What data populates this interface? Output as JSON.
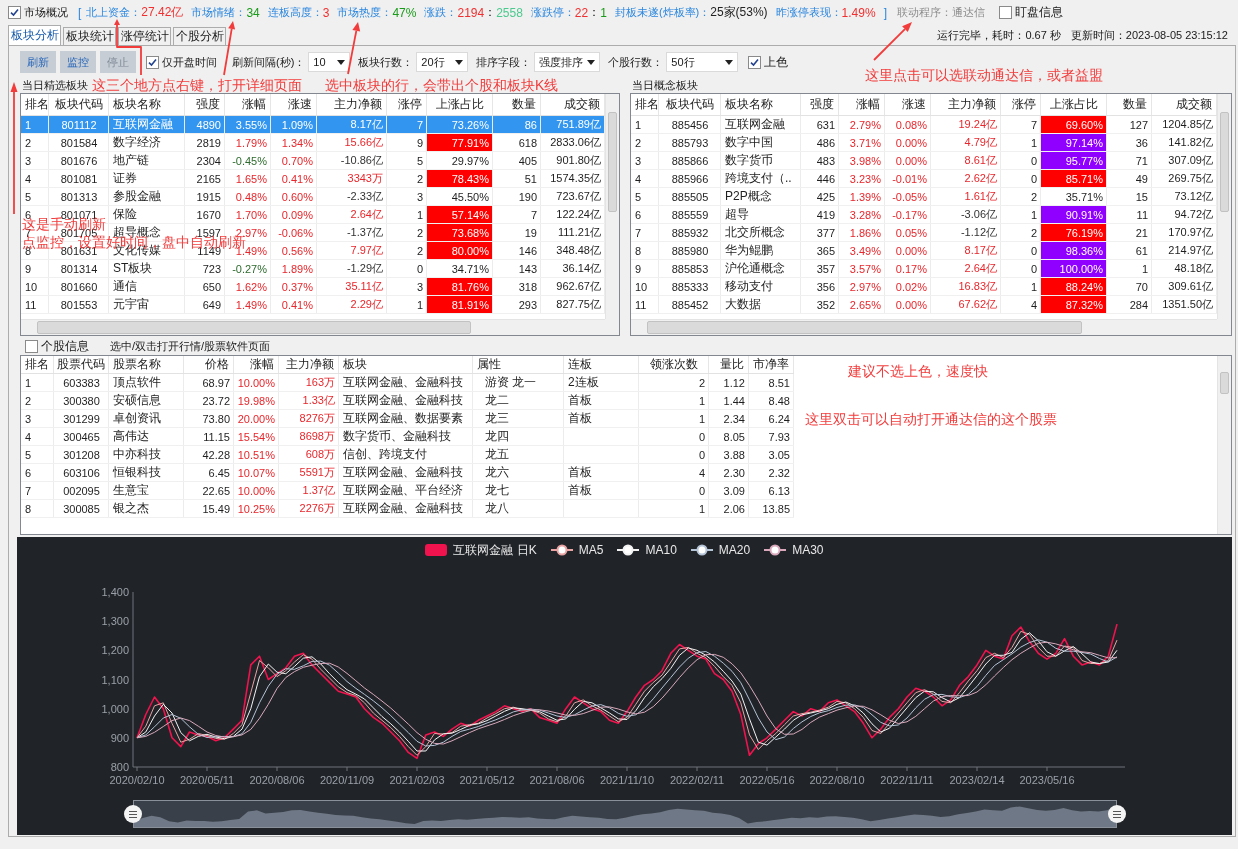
{
  "market_bar": {
    "overview_checkbox": {
      "label": "市场概况",
      "checked": true
    },
    "open_bracket": "[",
    "stats": [
      {
        "label": "北上资金：",
        "values": [
          {
            "text": "27.42亿",
            "color": "#f03030"
          }
        ]
      },
      {
        "label": "市场情绪：",
        "values": [
          {
            "text": "34",
            "color": "#1a9a1a"
          }
        ]
      },
      {
        "label": "连板高度：",
        "values": [
          {
            "text": "3",
            "color": "#f03030"
          }
        ]
      },
      {
        "label": "市场热度：",
        "values": [
          {
            "text": "47%",
            "color": "#1a9a1a"
          }
        ]
      },
      {
        "label": "涨跌：",
        "values": [
          {
            "text": "2194",
            "color": "#f03030"
          },
          {
            "text": "："
          },
          {
            "text": "2558",
            "color": "#4cc98f"
          }
        ]
      },
      {
        "label": "涨跌停：",
        "values": [
          {
            "text": "22",
            "color": "#f03030"
          },
          {
            "text": "："
          },
          {
            "text": "1",
            "color": "#1a9a1a"
          }
        ]
      },
      {
        "label": "封板未遂(炸板率)：",
        "values": [
          {
            "text": "25家(53%)",
            "color": "#222222"
          }
        ]
      },
      {
        "label": "昨涨停表现：",
        "values": [
          {
            "text": "1.49%",
            "color": "#f03030"
          }
        ]
      }
    ],
    "close_bracket": "]",
    "link_program": "联动程序：通达信",
    "watch_checkbox": {
      "label": "盯盘信息",
      "checked": false
    }
  },
  "tabs": [
    {
      "label": "板块分析",
      "selected": true
    },
    {
      "label": "板块统计",
      "selected": false
    },
    {
      "label": "涨停统计",
      "selected": false
    },
    {
      "label": "个股分析",
      "selected": false
    }
  ],
  "run_status": {
    "elapsed": "运行完毕，耗时：0.67 秒",
    "updated": "更新时间：2023-08-05 23:15:12"
  },
  "toolbar": {
    "buttons": [
      {
        "label": "刷新",
        "disabled": false
      },
      {
        "label": "监控",
        "disabled": false
      },
      {
        "label": "停止",
        "disabled": true
      }
    ],
    "open_time_checkbox": {
      "label": "仅开盘时间",
      "checked": true
    },
    "dropdowns": [
      {
        "label": "刷新间隔(秒)：",
        "value": "10"
      },
      {
        "label": "板块行数：",
        "value": "20行"
      },
      {
        "label": "排序字段：",
        "value": "强度排序"
      },
      {
        "label": "个股行数：",
        "value": "50行"
      }
    ],
    "color_checkbox": {
      "label": "上色",
      "checked": true
    }
  },
  "sector_panels": [
    {
      "title": "当日精选板块",
      "columns": [
        "排名",
        "板块代码",
        "板块名称",
        "强度",
        "涨幅",
        "涨速",
        "主力净额",
        "涨停",
        "上涨占比",
        "数量",
        "成交额"
      ],
      "rows": [
        {
          "rank": "1",
          "code": "801112",
          "name": "互联网金融",
          "strength": "4890",
          "change": "3.55%",
          "change_up": true,
          "speed": "1.09%",
          "net_flow": "8.17亿",
          "net_flow_up": true,
          "limit_up": "7",
          "rise_ratio": "73.26%",
          "count": "86",
          "turnover": "751.89亿",
          "selected": true
        },
        {
          "rank": "2",
          "code": "801584",
          "name": "数字经济",
          "strength": "2819",
          "change": "1.79%",
          "change_up": true,
          "speed": "1.34%",
          "net_flow": "15.66亿",
          "net_flow_up": true,
          "limit_up": "9",
          "rise_ratio": "77.91%",
          "color": "#ff0000",
          "count": "618",
          "turnover": "2833.06亿",
          "selected": false
        },
        {
          "rank": "3",
          "code": "801676",
          "name": "地产链",
          "strength": "2304",
          "change": "-0.45%",
          "change_up": false,
          "speed": "0.70%",
          "net_flow": "-10.86亿",
          "net_flow_up": false,
          "limit_up": "5",
          "rise_ratio": "29.97%",
          "count": "405",
          "turnover": "901.80亿",
          "selected": false
        },
        {
          "rank": "4",
          "code": "801081",
          "name": "证券",
          "strength": "2165",
          "change": "1.65%",
          "change_up": true,
          "speed": "0.41%",
          "net_flow": "3343万",
          "net_flow_up": true,
          "limit_up": "2",
          "rise_ratio": "78.43%",
          "color": "#ff0000",
          "count": "51",
          "turnover": "1574.35亿",
          "selected": false
        },
        {
          "rank": "5",
          "code": "801313",
          "name": "参股金融",
          "strength": "1915",
          "change": "0.48%",
          "change_up": true,
          "speed": "0.60%",
          "net_flow": "-2.33亿",
          "net_flow_up": false,
          "limit_up": "3",
          "rise_ratio": "45.50%",
          "count": "190",
          "turnover": "723.67亿",
          "selected": false
        },
        {
          "rank": "6",
          "code": "801071",
          "name": "保险",
          "strength": "1670",
          "change": "1.70%",
          "change_up": true,
          "speed": "0.09%",
          "net_flow": "2.64亿",
          "net_flow_up": true,
          "limit_up": "1",
          "rise_ratio": "57.14%",
          "color": "#ff0000",
          "count": "7",
          "turnover": "122.24亿",
          "selected": false
        },
        {
          "rank": "7",
          "code": "801705",
          "name": "超导概念",
          "strength": "1597",
          "change": "2.97%",
          "change_up": true,
          "speed": "-0.06%",
          "net_flow": "-1.37亿",
          "net_flow_up": false,
          "limit_up": "2",
          "rise_ratio": "73.68%",
          "color": "#ff0000",
          "count": "19",
          "turnover": "111.21亿",
          "selected": false
        },
        {
          "rank": "8",
          "code": "801631",
          "name": "文化传媒",
          "strength": "1149",
          "change": "1.49%",
          "change_up": true,
          "speed": "0.56%",
          "net_flow": "7.97亿",
          "net_flow_up": true,
          "limit_up": "2",
          "rise_ratio": "80.00%",
          "color": "#ff0000",
          "count": "146",
          "turnover": "348.48亿",
          "selected": false
        },
        {
          "rank": "9",
          "code": "801314",
          "name": "ST板块",
          "strength": "723",
          "change": "-0.27%",
          "change_up": false,
          "speed": "1.89%",
          "net_flow": "-1.29亿",
          "net_flow_up": false,
          "limit_up": "0",
          "rise_ratio": "34.71%",
          "count": "143",
          "turnover": "36.14亿",
          "selected": false
        },
        {
          "rank": "10",
          "code": "801660",
          "name": "通信",
          "strength": "650",
          "change": "1.62%",
          "change_up": true,
          "speed": "0.37%",
          "net_flow": "35.11亿",
          "net_flow_up": true,
          "limit_up": "3",
          "rise_ratio": "81.76%",
          "color": "#ff0000",
          "count": "318",
          "turnover": "962.67亿",
          "selected": false
        },
        {
          "rank": "11",
          "code": "801553",
          "name": "元宇宙",
          "strength": "649",
          "change": "1.49%",
          "change_up": true,
          "speed": "0.41%",
          "net_flow": "2.29亿",
          "net_flow_up": true,
          "limit_up": "1",
          "rise_ratio": "81.91%",
          "color": "#ff0000",
          "count": "293",
          "turnover": "827.75亿",
          "selected": false
        }
      ]
    },
    {
      "title": "当日概念板块",
      "columns": [
        "排名",
        "板块代码",
        "板块名称",
        "强度",
        "涨幅",
        "涨速",
        "主力净额",
        "涨停",
        "上涨占比",
        "数量",
        "成交额"
      ],
      "rows": [
        {
          "rank": "1",
          "code": "885456",
          "name": "互联网金融",
          "strength": "631",
          "change": "2.79%",
          "change_up": true,
          "speed": "0.08%",
          "net_flow": "19.24亿",
          "net_flow_up": true,
          "limit_up": "7",
          "rise_ratio": "69.60%",
          "color": "#ff0000",
          "count": "127",
          "turnover": "1204.85亿",
          "selected": false
        },
        {
          "rank": "2",
          "code": "885793",
          "name": "数字中国",
          "strength": "486",
          "change": "3.71%",
          "change_up": true,
          "speed": "0.00%",
          "net_flow": "4.79亿",
          "net_flow_up": true,
          "limit_up": "1",
          "rise_ratio": "97.14%",
          "color": "#9000ff",
          "count": "36",
          "turnover": "141.82亿",
          "selected": false
        },
        {
          "rank": "3",
          "code": "885866",
          "name": "数字货币",
          "strength": "483",
          "change": "3.98%",
          "change_up": true,
          "speed": "0.00%",
          "net_flow": "8.61亿",
          "net_flow_up": true,
          "limit_up": "0",
          "rise_ratio": "95.77%",
          "color": "#9000ff",
          "count": "71",
          "turnover": "307.09亿",
          "selected": false
        },
        {
          "rank": "4",
          "code": "885966",
          "name": "跨境支付（..",
          "strength": "446",
          "change": "3.23%",
          "change_up": true,
          "speed": "-0.01%",
          "net_flow": "2.62亿",
          "net_flow_up": true,
          "limit_up": "0",
          "rise_ratio": "85.71%",
          "color": "#ff0000",
          "count": "49",
          "turnover": "269.75亿",
          "selected": false
        },
        {
          "rank": "5",
          "code": "885505",
          "name": "P2P概念",
          "strength": "425",
          "change": "1.39%",
          "change_up": true,
          "speed": "-0.05%",
          "net_flow": "1.61亿",
          "net_flow_up": true,
          "limit_up": "2",
          "rise_ratio": "35.71%",
          "count": "15",
          "turnover": "73.12亿",
          "selected": false
        },
        {
          "rank": "6",
          "code": "885559",
          "name": "超导",
          "strength": "419",
          "change": "3.28%",
          "change_up": true,
          "speed": "-0.17%",
          "net_flow": "-3.06亿",
          "net_flow_up": false,
          "limit_up": "1",
          "rise_ratio": "90.91%",
          "color": "#9000ff",
          "count": "11",
          "turnover": "94.72亿",
          "selected": false
        },
        {
          "rank": "7",
          "code": "885932",
          "name": "北交所概念",
          "strength": "377",
          "change": "1.86%",
          "change_up": true,
          "speed": "0.05%",
          "net_flow": "-1.12亿",
          "net_flow_up": false,
          "limit_up": "2",
          "rise_ratio": "76.19%",
          "color": "#ff0000",
          "count": "21",
          "turnover": "170.97亿",
          "selected": false
        },
        {
          "rank": "8",
          "code": "885980",
          "name": "华为鲲鹏",
          "strength": "365",
          "change": "3.49%",
          "change_up": true,
          "speed": "0.00%",
          "net_flow": "8.17亿",
          "net_flow_up": true,
          "limit_up": "0",
          "rise_ratio": "98.36%",
          "color": "#9000ff",
          "count": "61",
          "turnover": "214.97亿",
          "selected": false
        },
        {
          "rank": "9",
          "code": "885853",
          "name": "沪伦通概念",
          "strength": "357",
          "change": "3.57%",
          "change_up": true,
          "speed": "0.17%",
          "net_flow": "2.64亿",
          "net_flow_up": true,
          "limit_up": "0",
          "rise_ratio": "100.00%",
          "color": "#9000ff",
          "count": "1",
          "turnover": "48.18亿",
          "selected": false
        },
        {
          "rank": "10",
          "code": "885333",
          "name": "移动支付",
          "strength": "356",
          "change": "2.97%",
          "change_up": true,
          "speed": "0.02%",
          "net_flow": "16.83亿",
          "net_flow_up": true,
          "limit_up": "1",
          "rise_ratio": "88.24%",
          "color": "#ff0000",
          "count": "70",
          "turnover": "309.61亿",
          "selected": false
        },
        {
          "rank": "11",
          "code": "885452",
          "name": "大数据",
          "strength": "352",
          "change": "2.65%",
          "change_up": true,
          "speed": "0.00%",
          "net_flow": "67.62亿",
          "net_flow_up": true,
          "limit_up": "4",
          "rise_ratio": "87.32%",
          "color": "#ff0000",
          "count": "284",
          "turnover": "1351.50亿",
          "selected": false
        }
      ]
    }
  ],
  "stock_panel": {
    "info_checkbox": {
      "label": "个股信息",
      "checked": false
    },
    "hint": "选中/双击打开行情/股票软件页面",
    "columns": [
      "排名",
      "股票代码",
      "股票名称",
      "价格",
      "涨幅",
      "主力净额",
      "板块",
      "属性",
      "连板",
      "领涨次数",
      "量比",
      "市净率"
    ],
    "rows": [
      {
        "rank": "1",
        "code": "603383",
        "name": "顶点软件",
        "price": "68.97",
        "change": "10.00%",
        "net_flow": "163万",
        "sectors": "互联网金融、金融科技",
        "attribute": "游资 龙一",
        "streak": "2连板",
        "lead_count": "2",
        "volume_ratio": "1.12",
        "pb": "8.51"
      },
      {
        "rank": "2",
        "code": "300380",
        "name": "安硕信息",
        "price": "23.72",
        "change": "19.98%",
        "net_flow": "1.33亿",
        "sectors": "互联网金融、金融科技",
        "attribute": "龙二",
        "streak": "首板",
        "lead_count": "1",
        "volume_ratio": "1.44",
        "pb": "8.48"
      },
      {
        "rank": "3",
        "code": "301299",
        "name": "卓创资讯",
        "price": "73.80",
        "change": "20.00%",
        "net_flow": "8276万",
        "sectors": "互联网金融、数据要素",
        "attribute": "龙三",
        "streak": "首板",
        "lead_count": "1",
        "volume_ratio": "2.34",
        "pb": "6.24"
      },
      {
        "rank": "4",
        "code": "300465",
        "name": "高伟达",
        "price": "11.15",
        "change": "15.54%",
        "net_flow": "8698万",
        "sectors": "数字货币、金融科技",
        "attribute": "龙四",
        "lead_count": "0",
        "volume_ratio": "8.05",
        "pb": "7.93"
      },
      {
        "rank": "5",
        "code": "301208",
        "name": "中亦科技",
        "price": "42.28",
        "change": "10.51%",
        "net_flow": "608万",
        "sectors": "信创、跨境支付",
        "attribute": "龙五",
        "lead_count": "0",
        "volume_ratio": "3.88",
        "pb": "3.05"
      },
      {
        "rank": "6",
        "code": "603106",
        "name": "恒银科技",
        "price": "6.45",
        "change": "10.07%",
        "net_flow": "5591万",
        "sectors": "互联网金融、金融科技",
        "attribute": "龙六",
        "streak": "首板",
        "lead_count": "4",
        "volume_ratio": "2.30",
        "pb": "2.32"
      },
      {
        "rank": "7",
        "code": "002095",
        "name": "生意宝",
        "price": "22.65",
        "change": "10.00%",
        "net_flow": "1.37亿",
        "sectors": "互联网金融、平台经济",
        "attribute": "龙七",
        "streak": "首板",
        "lead_count": "0",
        "volume_ratio": "3.09",
        "pb": "6.13"
      },
      {
        "rank": "8",
        "code": "300085",
        "name": "银之杰",
        "price": "15.49",
        "change": "10.25%",
        "net_flow": "2276万",
        "sectors": "互联网金融、金融科技",
        "attribute": "龙八",
        "lead_count": "1",
        "volume_ratio": "2.06",
        "pb": "13.85"
      }
    ]
  },
  "kline": {
    "chart_data": {
      "type": "line",
      "legend": "top",
      "categories": [
        "2020/02/10",
        null,
        null,
        null,
        null,
        null,
        null,
        null,
        "2020/05/11",
        null,
        null,
        null,
        null,
        null,
        null,
        null,
        "2020/08/06",
        null,
        null,
        null,
        null,
        null,
        null,
        null,
        "2020/11/09",
        null,
        null,
        null,
        null,
        null,
        null,
        null,
        "2021/02/03",
        null,
        null,
        null,
        null,
        null,
        null,
        null,
        "2021/05/12",
        null,
        null,
        null,
        null,
        null,
        null,
        null,
        "2021/08/06",
        null,
        null,
        null,
        null,
        null,
        null,
        null,
        "2021/11/10",
        null,
        null,
        null,
        null,
        null,
        null,
        null,
        "2022/02/11",
        null,
        null,
        null,
        null,
        null,
        null,
        null,
        "2022/05/16",
        null,
        null,
        null,
        null,
        null,
        null,
        null,
        "2022/08/10",
        null,
        null,
        null,
        null,
        null,
        null,
        null,
        "2022/11/11",
        null,
        null,
        null,
        null,
        null,
        null,
        null,
        "2023/02/14",
        null,
        null,
        null,
        null,
        null,
        null,
        null,
        "2023/05/16",
        null,
        null,
        null,
        null,
        null,
        null,
        null,
        null
      ],
      "yticks": [
        800,
        900,
        {
          "value": 1000,
          "label": "1,000"
        },
        {
          "value": 1100,
          "label": "1,100"
        },
        {
          "value": 1200,
          "label": "1,200"
        },
        {
          "value": 1300,
          "label": "1,300"
        },
        {
          "value": 1400,
          "label": "1,400"
        }
      ],
      "ylim": [
        800,
        1400
      ],
      "series": [
        {
          "name": "互联网金融 日K",
          "color": "#f0134d",
          "values": [
            900,
            980,
            1040,
            1000,
            900,
            870,
            920,
            910,
            905,
            890,
            900,
            930,
            960,
            1150,
            1180,
            1100,
            1120,
            1140,
            1180,
            1190,
            1150,
            1120,
            1090,
            1060,
            1050,
            1040,
            1000,
            970,
            950,
            920,
            890,
            850,
            830,
            910,
            920,
            905,
            930,
            950,
            940,
            960,
            975,
            990,
            1010,
            1000,
            990,
            1000,
            970,
            960,
            950,
            1000,
            1040,
            1020,
            1000,
            990,
            960,
            950,
            990,
            1040,
            1080,
            1100,
            1130,
            1190,
            1220,
            1200,
            1180,
            1170,
            1120,
            1100,
            1060,
            980,
            840,
            880,
            900,
            930,
            960,
            990,
            975,
            1000,
            990,
            1020,
            1030,
            1010,
            990,
            950,
            900,
            930,
            970,
            1000,
            1040,
            1070,
            1060,
            1040,
            1010,
            1030,
            1080,
            1110,
            1150,
            1200,
            1180,
            1170,
            1250,
            1280,
            1230,
            1190,
            1170,
            1190,
            1240,
            1180,
            1150,
            1160,
            1150,
            1180,
            1290
          ]
        },
        {
          "name": "MA5",
          "color": "#e9a3a3",
          "values": [
            900,
            940,
            1010,
            1020,
            950,
            885,
            895,
            915,
            908,
            898,
            895,
            915,
            945,
            1055,
            1165,
            1140,
            1110,
            1130,
            1160,
            1185,
            1170,
            1135,
            1105,
            1075,
            1055,
            1045,
            1020,
            985,
            960,
            935,
            905,
            870,
            840,
            870,
            915,
            913,
            918,
            940,
            945,
            950,
            968,
            983,
            1000,
            1005,
            995,
            995,
            985,
            965,
            955,
            975,
            1020,
            1030,
            1010,
            995,
            975,
            955,
            970,
            1015,
            1060,
            1090,
            1115,
            1160,
            1205,
            1210,
            1190,
            1175,
            1145,
            1110,
            1080,
            1020,
            910,
            860,
            890,
            915,
            945,
            975,
            983,
            988,
            995,
            1005,
            1025,
            1020,
            1000,
            970,
            925,
            915,
            950,
            985,
            1020,
            1055,
            1065,
            1050,
            1025,
            1020,
            1055,
            1095,
            1130,
            1175,
            1190,
            1175,
            1210,
            1265,
            1255,
            1210,
            1180,
            1180,
            1215,
            1210,
            1165,
            1155,
            1155,
            1165,
            1235
          ]
        },
        {
          "name": "MA10",
          "color": "#f2f2f2",
          "values": [
            900,
            920,
            975,
            1015,
            985,
            918,
            890,
            905,
            912,
            903,
            897,
            905,
            930,
            1000,
            1110,
            1153,
            1125,
            1120,
            1145,
            1173,
            1178,
            1153,
            1120,
            1090,
            1065,
            1050,
            1033,
            1003,
            973,
            948,
            920,
            888,
            855,
            855,
            893,
            914,
            916,
            929,
            943,
            948,
            959,
            975,
            991,
            1003,
            1000,
            995,
            990,
            975,
            960,
            965,
            998,
            1025,
            1020,
            1003,
            985,
            965,
            963,
            993,
            1038,
            1075,
            1103,
            1138,
            1183,
            1208,
            1200,
            1183,
            1160,
            1128,
            1095,
            1050,
            965,
            885,
            875,
            903,
            930,
            960,
            979,
            985,
            992,
            1000,
            1015,
            1023,
            1010,
            985,
            948,
            920,
            933,
            968,
            1003,
            1038,
            1060,
            1058,
            1038,
            1023,
            1038,
            1075,
            1113,
            1153,
            1183,
            1183,
            1193,
            1238,
            1260,
            1233,
            1195,
            1180,
            1198,
            1213,
            1188,
            1160,
            1155,
            1160,
            1200
          ]
        },
        {
          "name": "MA20",
          "color": "#b4c3d6",
          "values": [
            900,
            910,
            938,
            968,
            980,
            967,
            938,
            912,
            901,
            904,
            905,
            904,
            914,
            953,
            1020,
            1077,
            1118,
            1137,
            1135,
            1147,
            1162,
            1163,
            1149,
            1122,
            1093,
            1070,
            1049,
            1027,
            1003,
            976,
            947,
            918,
            888,
            872,
            874,
            885,
            905,
            922,
            930,
            939,
            951,
            962,
            975,
            989,
            996,
            999,
            995,
            985,
            975,
            970,
            979,
            995,
            1009,
            1014,
            1003,
            984,
            974,
            979,
            1001,
            1034,
            1071,
            1107,
            1143,
            1173,
            1192,
            1196,
            1180,
            1156,
            1128,
            1089,
            1030,
            968,
            920,
            894,
            903,
            932,
            955,
            973,
            986,
            993,
            1004,
            1012,
            1013,
            1004,
            979,
            953,
            941,
            944,
            968,
            1003,
            1032,
            1048,
            1049,
            1041,
            1038,
            1049,
            1076,
            1114,
            1148,
            1168,
            1188,
            1211,
            1227,
            1236,
            1228,
            1207,
            1197,
            1197,
            1193,
            1187,
            1172,
            1160,
            1178
          ]
        },
        {
          "name": "MA30",
          "color": "#d9a9bb",
          "values": [
            900,
            905,
            919,
            939,
            959,
            968,
            959,
            940,
            920,
            908,
            903,
            904,
            910,
            929,
            967,
            1015,
            1069,
            1107,
            1127,
            1142,
            1149,
            1155,
            1156,
            1143,
            1121,
            1096,
            1071,
            1049,
            1026,
            1002,
            975,
            947,
            918,
            895,
            881,
            879,
            890,
            904,
            918,
            931,
            941,
            951,
            963,
            976,
            986,
            994,
            996,
            992,
            985,
            978,
            977,
            983,
            994,
            1005,
            1006,
            999,
            989,
            982,
            988,
            1007,
            1036,
            1071,
            1107,
            1140,
            1168,
            1185,
            1186,
            1176,
            1154,
            1123,
            1079,
            1029,
            975,
            931,
            912,
            913,
            929,
            953,
            971,
            983,
            995,
            1003,
            1009,
            1008,
            996,
            979,
            960,
            949,
            955,
            974,
            1000,
            1026,
            1041,
            1045,
            1044,
            1045,
            1057,
            1082,
            1112,
            1141,
            1168,
            1190,
            1208,
            1224,
            1228,
            1222,
            1213,
            1202,
            1195,
            1192,
            1183,
            1174,
            1175
          ]
        }
      ]
    }
  },
  "annotations": [
    {
      "lines": [
        "这三个地方点右键，打开详细页面"
      ]
    },
    {
      "lines": [
        "选中板块的行，会带出个股和板块K线"
      ]
    },
    {
      "lines": [
        "这里点击可以选联动通达信，或者益盟"
      ]
    },
    {
      "lines": [
        "这是手动刷新",
        "点监控，设置好时间，盘中自动刷新"
      ]
    },
    {
      "lines": [
        "建议不选上色，速度快"
      ]
    },
    {
      "lines": [
        "这里双击可以自动打开通达信的这个股票"
      ]
    }
  ]
}
